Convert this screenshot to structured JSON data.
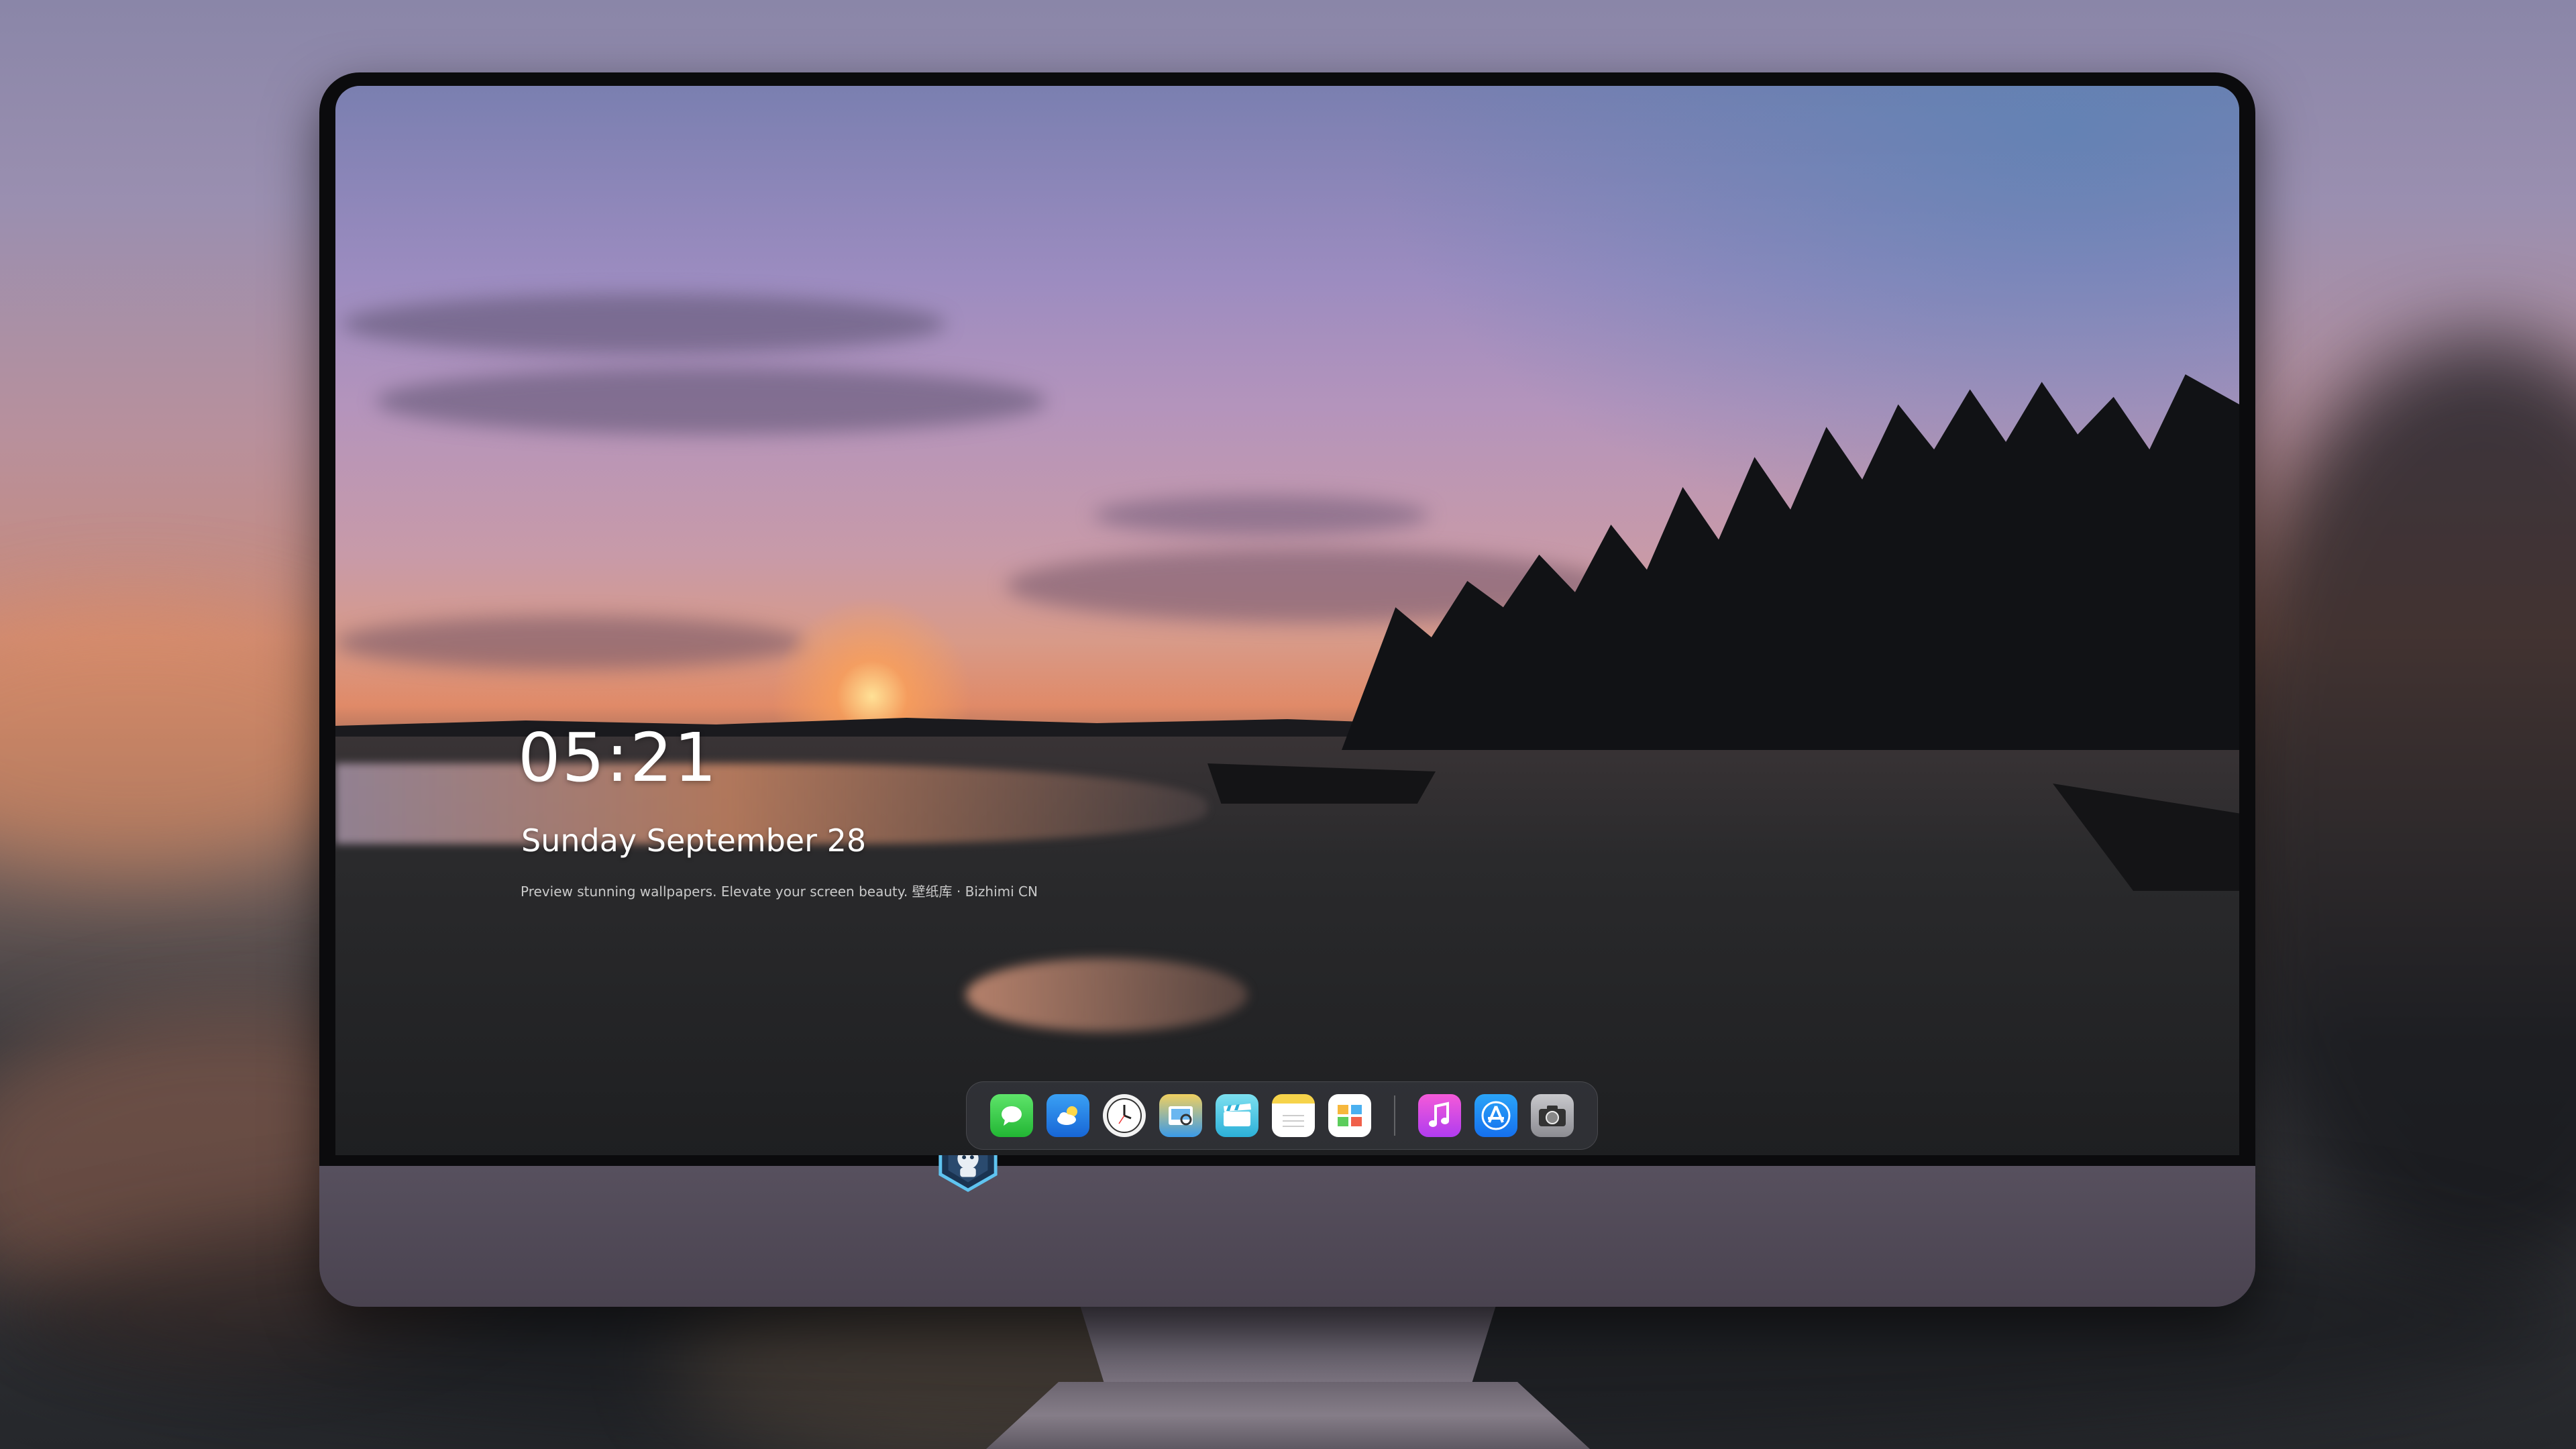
{
  "lockscreen": {
    "time": "05:21",
    "date": "Sunday September  28",
    "caption": "Preview stunning wallpapers. Elevate your screen beauty. 壁纸库 · Bizhimi CN"
  },
  "dock": {
    "apps": [
      {
        "name": "Messages",
        "icon": "message-bubble-icon"
      },
      {
        "name": "Weather",
        "icon": "weather-cloud-icon"
      },
      {
        "name": "Clock",
        "icon": "clock-icon"
      },
      {
        "name": "Preview",
        "icon": "preview-icon"
      },
      {
        "name": "Clips",
        "icon": "clapperboard-icon"
      },
      {
        "name": "Notes",
        "icon": "notes-icon"
      },
      {
        "name": "Photos",
        "icon": "photos-icon"
      },
      {
        "name": "Music",
        "icon": "music-note-icon"
      },
      {
        "name": "App Store",
        "icon": "app-store-icon"
      },
      {
        "name": "Camera",
        "icon": "camera-icon"
      }
    ]
  },
  "colors": {
    "dock_background": "#3c3e46",
    "monitor_chin": "#4f4856",
    "text": "#ffffff"
  }
}
